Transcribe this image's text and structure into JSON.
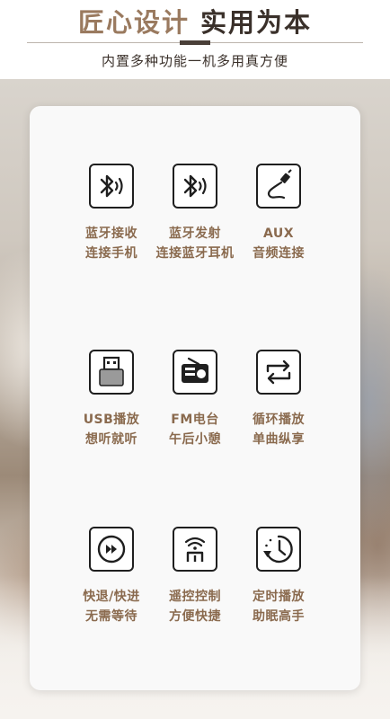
{
  "header": {
    "title_accent": "匠心设计",
    "title_main": "实用为本",
    "subtitle": "内置多种功能一机多用真方便"
  },
  "features": [
    {
      "icon": "bluetooth-receive-icon",
      "line1": "蓝牙接收",
      "line2": "连接手机"
    },
    {
      "icon": "bluetooth-transmit-icon",
      "line1": "蓝牙发射",
      "line2": "连接蓝牙耳机"
    },
    {
      "icon": "aux-cable-icon",
      "line1": "AUX",
      "line2": "音频连接"
    },
    {
      "icon": "usb-icon",
      "line1": "USB播放",
      "line2": "想听就听"
    },
    {
      "icon": "radio-icon",
      "line1": "FM电台",
      "line2": "午后小憩"
    },
    {
      "icon": "loop-icon",
      "line1": "循环播放",
      "line2": "单曲纵享"
    },
    {
      "icon": "fast-forward-icon",
      "line1": "快退/快进",
      "line2": "无需等待"
    },
    {
      "icon": "remote-control-icon",
      "line1": "遥控控制",
      "line2": "方便快捷"
    },
    {
      "icon": "timer-icon",
      "line1": "定时播放",
      "line2": "助眠高手"
    }
  ],
  "colors": {
    "accent": "#9a7a5f",
    "label": "#8a6a4e",
    "dark": "#3a302a"
  }
}
